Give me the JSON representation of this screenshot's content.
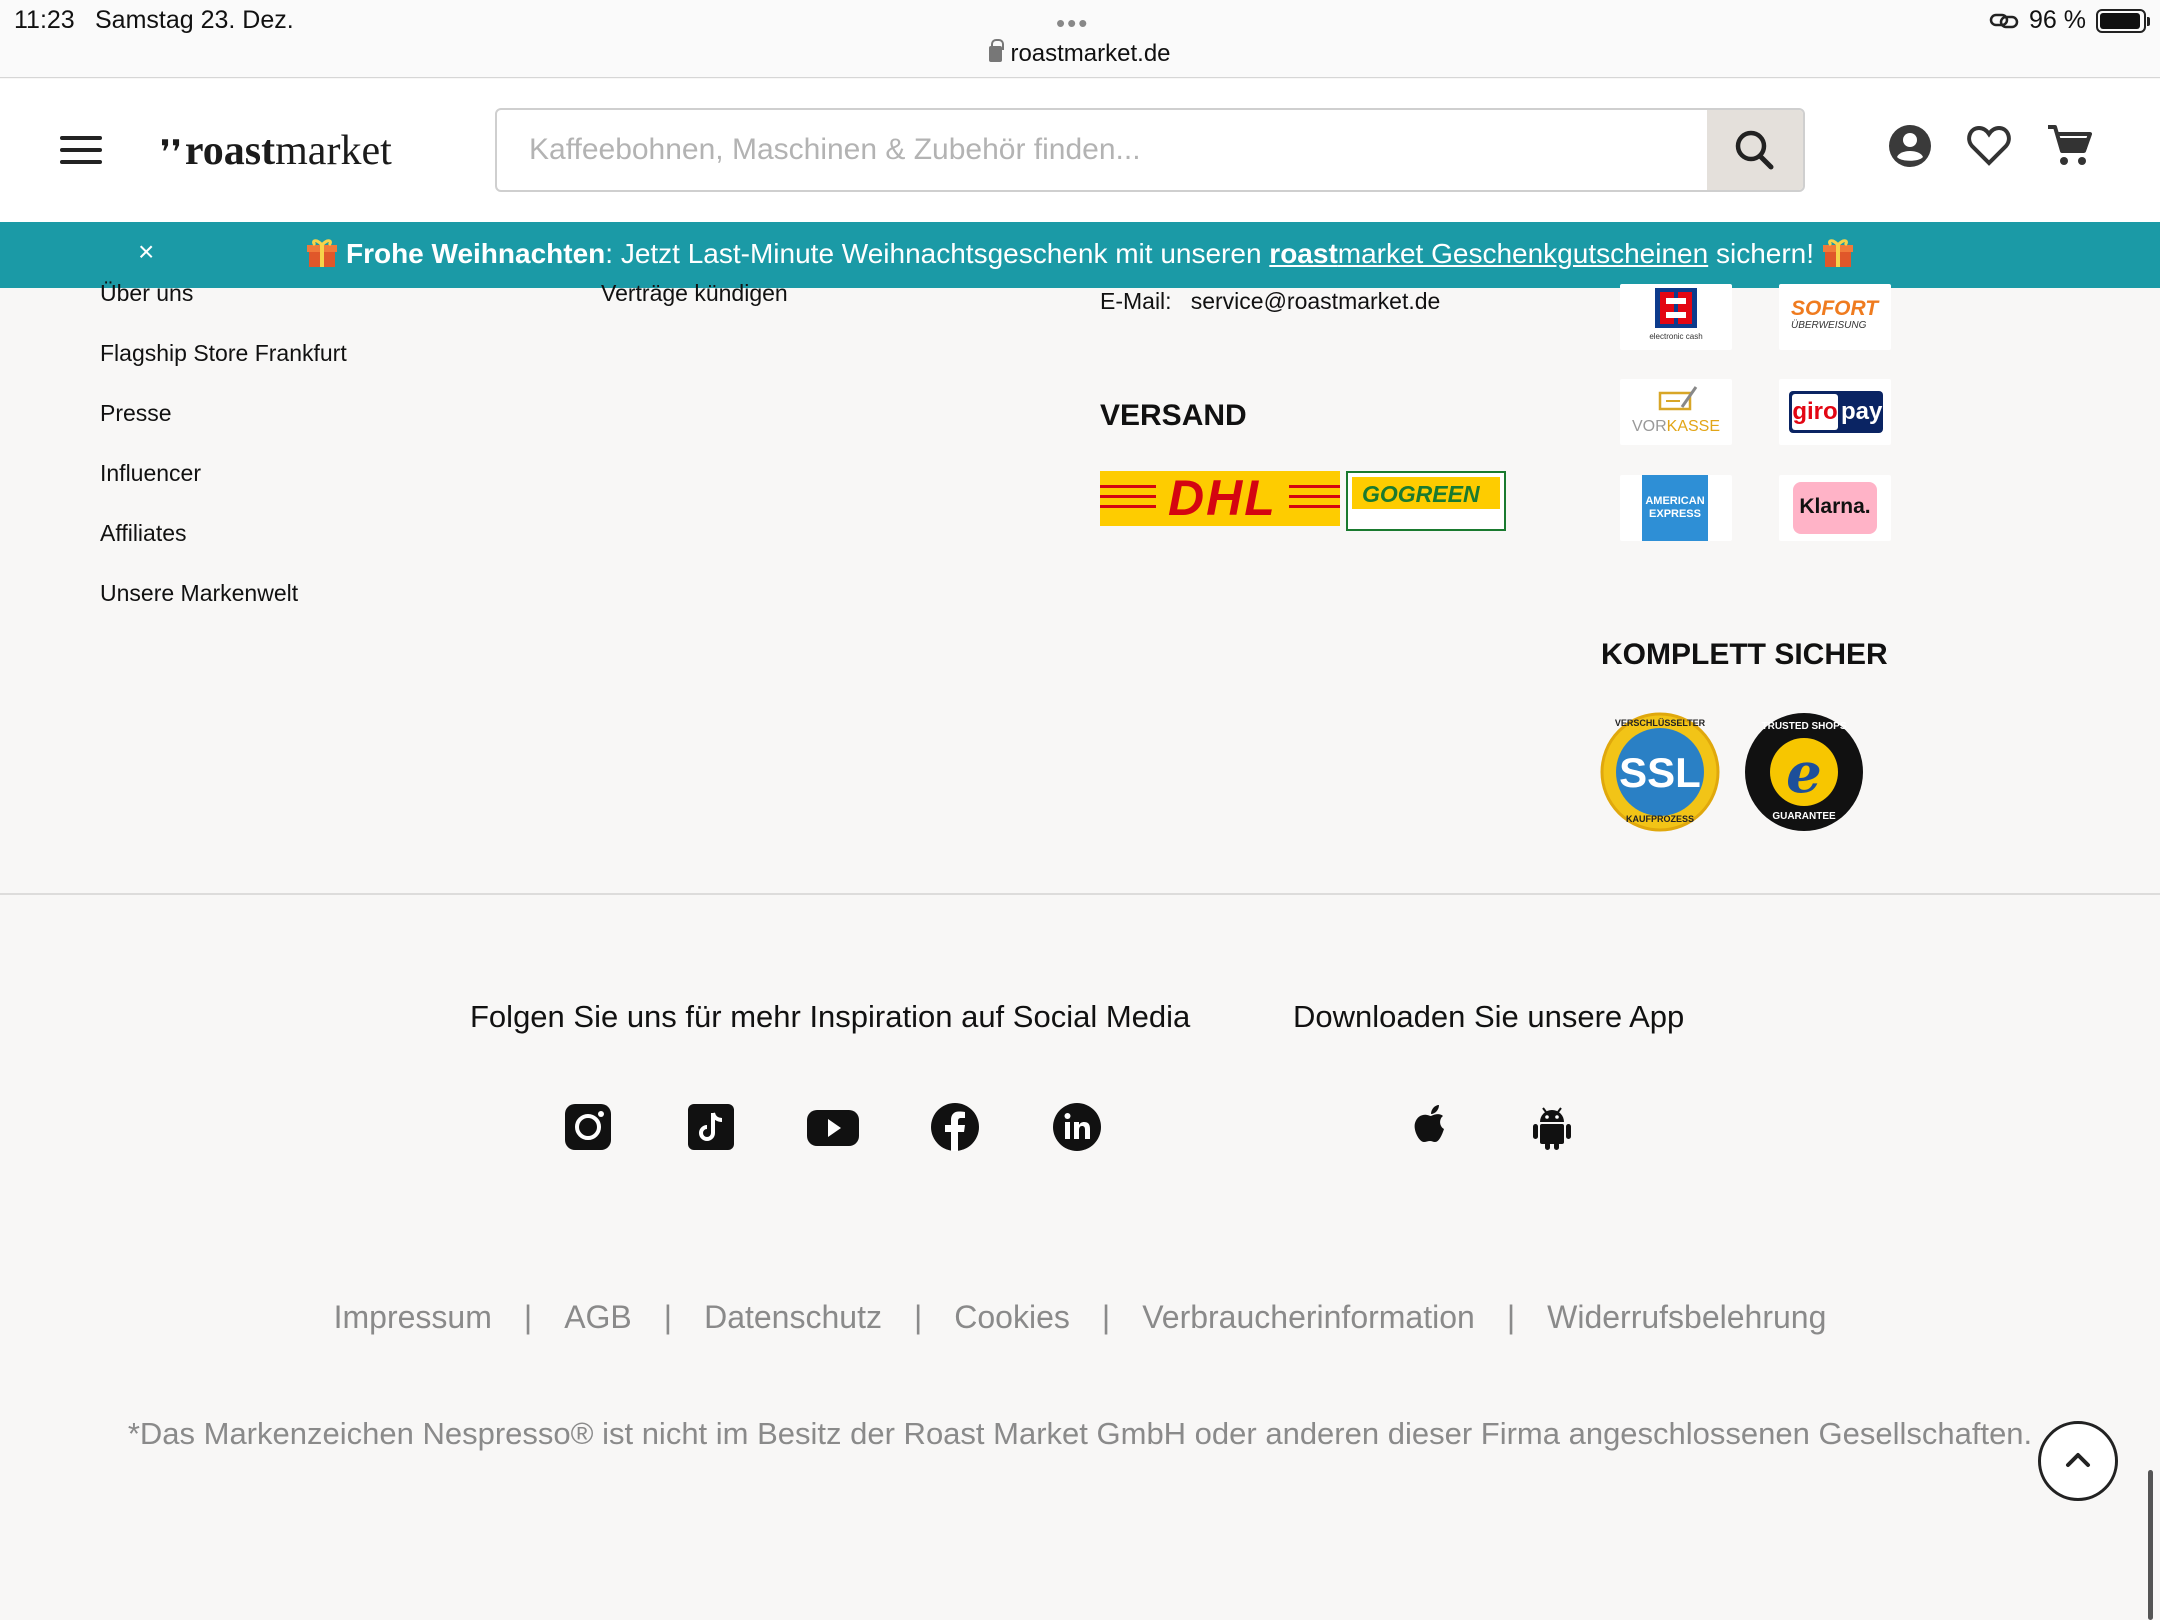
{
  "status_bar": {
    "time": "11:23",
    "date": "Samstag 23. Dez.",
    "dots": "•••",
    "url": "roastmarket.de",
    "battery": "96 %",
    "battery_level": 0.96
  },
  "header": {
    "logo_bold": "roast",
    "logo_regular": "market",
    "search_placeholder": "Kaffeebohnen, Maschinen & Zubehör finden..."
  },
  "promo": {
    "close": "×",
    "bold": "Frohe Weihnachten",
    "text1": ": Jetzt Last-Minute Weihnachtsgeschenk mit unseren ",
    "link_bold": "roast",
    "link_rest": "market Geschenkgutscheinen",
    "text2": " sichern!"
  },
  "footer_links_col1": [
    "Über uns",
    "Flagship Store Frankfurt",
    "Presse",
    "Influencer",
    "Affiliates",
    "Unsere Markenwelt"
  ],
  "footer_links_col2": [
    "Verträge kündigen"
  ],
  "contact": {
    "email_label": "E-Mail:",
    "email": "service@roastmarket.de"
  },
  "versand": {
    "heading": "VERSAND",
    "dhl": "DHL",
    "gogreen": "GOGREEN"
  },
  "payment": {
    "ec": "electronic cash",
    "sofort": "SOFORT",
    "sofort_sub": "ÜBERWEISUNG",
    "vorkasse_a": "VOR",
    "vorkasse_b": "KASSE",
    "giro_a": "giro",
    "giro_b": "pay",
    "amex_a": "AMERICAN",
    "amex_b": "EXPRESS",
    "klarna": "Klarna."
  },
  "security": {
    "heading": "KOMPLETT SICHER",
    "ssl": "SSL",
    "ssl_top": "VERSCHLÜSSELTER",
    "ssl_bottom": "KAUFPROZESS",
    "trusted_top": "TRUSTED SHOPS",
    "trusted_bottom": "GUARANTEE"
  },
  "social": {
    "title": "Folgen Sie uns für mehr Inspiration auf Social Media",
    "icons": [
      "instagram-icon",
      "tiktok-icon",
      "youtube-icon",
      "facebook-icon",
      "linkedin-icon"
    ]
  },
  "app": {
    "title": "Downloaden Sie unsere App",
    "icons": [
      "apple-icon",
      "android-icon"
    ]
  },
  "legal": [
    "Impressum",
    "AGB",
    "Datenschutz",
    "Cookies",
    "Verbraucherinformation",
    "Widerrufsbelehrung"
  ],
  "legal_sep": "|",
  "disclaimer": "*Das Markenzeichen Nespresso® ist nicht im Besitz der Roast Market GmbH oder anderen dieser Firma angeschlossenen Gesellschaften."
}
